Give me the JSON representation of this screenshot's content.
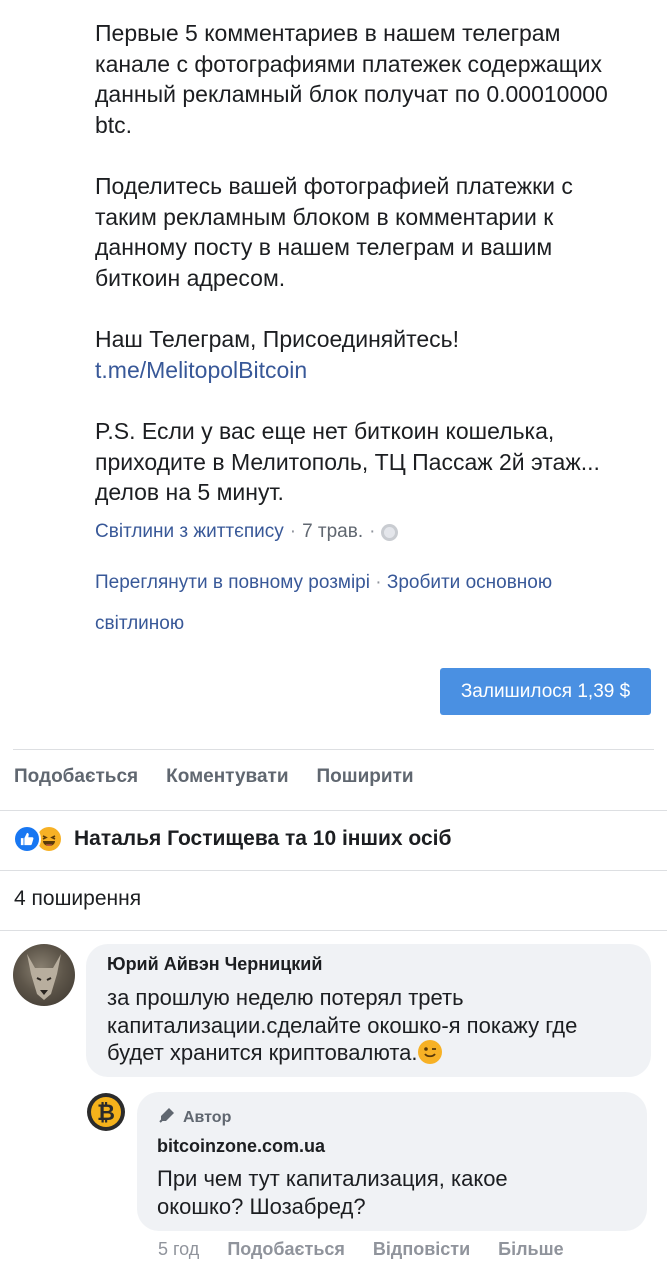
{
  "post": {
    "paragraphs": [
      "Первые 5 комментариев в нашем телеграм\nканале с фотографиями платежек содержащих\nданный рекламный блок получат по 0.00010000\nbtc.",
      "Поделитесь вашей фотографией платежки с\nтаким рекламным блоком в комментарии к\nданному посту в нашем телеграм и вашим\nбиткоин адресом.",
      "Наш Телеграм, Присоединяйтесь!",
      "P.S. Если у вас еще нет биткоин кошелька,\nприходите в Мелитополь, ТЦ Пассаж 2й этаж...\nделов на 5 минут."
    ],
    "telegram_link": "t.me/MelitopolBitcoin"
  },
  "meta": {
    "album": "Світлини з життєпису",
    "separator": "·",
    "date": "7 трав.",
    "view_full": "Переглянути в повному розмірі",
    "make_profile": "Зробити основною світлиною"
  },
  "remaining_button": "Залишилося 1,39 $",
  "action_bar": {
    "like": "Подобається",
    "comment": "Коментувати",
    "share": "Поширити"
  },
  "reactions": {
    "label": "Наталья Гостищева та 10 інших осіб",
    "like_color": "#1877f2",
    "haha_color": "#f7b125"
  },
  "shares_text": "4 поширення",
  "comment": {
    "author": "Юрий Айвэн Черницкий",
    "text": "за прошлую неделю потерял треть\nкапитализации.сделайте окошко-я покажу где\nбудет хранится криптовалюта."
  },
  "reply": {
    "badge": "Автор",
    "page": "bitcoinzone.com.ua",
    "text": "При чем тут капитализация, какое\nокошко? Шозабред?",
    "time": "5 год",
    "like": "Подобається",
    "respond": "Відповісти",
    "more": "Більше",
    "avatar_symbol": "₿"
  }
}
